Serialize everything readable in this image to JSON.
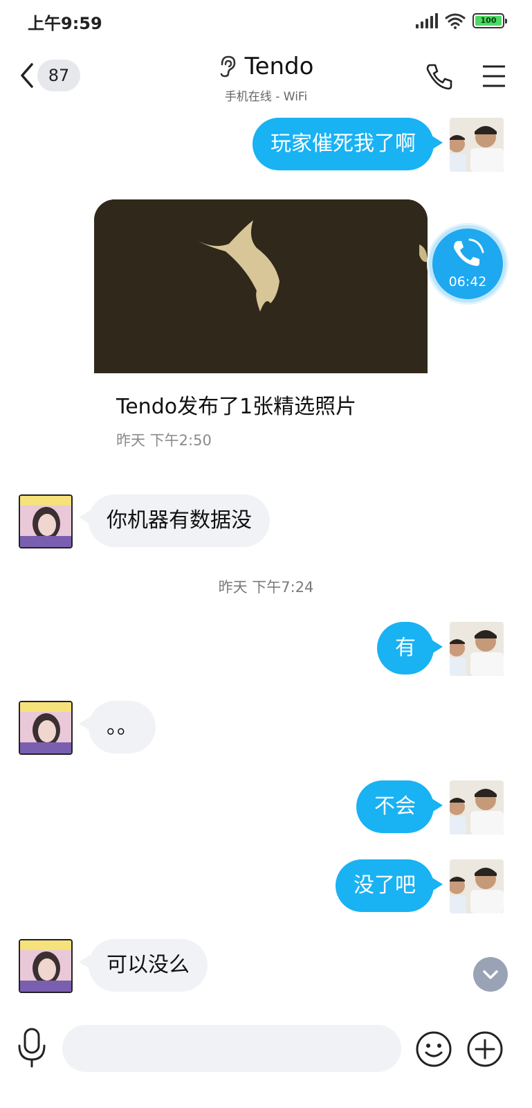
{
  "status_bar": {
    "time": "上午9:59",
    "battery": "100"
  },
  "header": {
    "unread_count": "87",
    "title": "Tendo",
    "subtitle": "手机在线 - WiFi"
  },
  "messages": [
    {
      "from": "me",
      "text": "玩家催死我了啊"
    },
    {
      "from": "them",
      "text": "你机器有数据没"
    },
    {
      "from": "me",
      "text": "有"
    },
    {
      "from": "them",
      "text": "。。"
    },
    {
      "from": "me",
      "text": "不会"
    },
    {
      "from": "me",
      "text": "没了吧"
    },
    {
      "from": "them",
      "text": "可以没么"
    }
  ],
  "photo_post": {
    "caption": "Tendo发布了1张精选照片",
    "time": "昨天 下午2:50"
  },
  "timestamp_divider": "昨天 下午7:24",
  "call_float": {
    "duration": "06:42"
  },
  "input": {
    "placeholder": ""
  },
  "colors": {
    "my_bubble": "#19b2f3",
    "their_bubble": "#f1f2f6",
    "accent": "#1ea8ef"
  },
  "icons": [
    "back-icon",
    "ear-icon",
    "phone-icon",
    "menu-icon",
    "call-icon",
    "chevron-down-icon",
    "microphone-icon",
    "emoji-icon",
    "plus-icon"
  ]
}
